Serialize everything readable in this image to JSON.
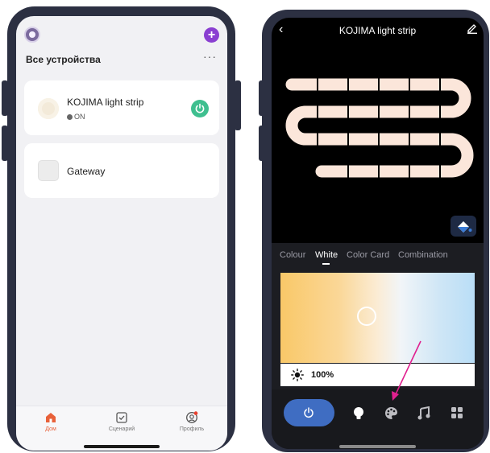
{
  "left_screen": {
    "header": {
      "avatar_icon": "avatar-icon",
      "add_icon": "plus-icon",
      "add_label": "+"
    },
    "section_title": "Все устройства",
    "more_label": "···",
    "devices": [
      {
        "name": "KOJIMA light strip",
        "status": "ON",
        "icon": "light-icon",
        "power_icon": "power-icon"
      },
      {
        "name": "Gateway",
        "icon": "gateway-icon"
      }
    ],
    "tabs": [
      {
        "label": "Дом",
        "icon": "home-icon",
        "active": true
      },
      {
        "label": "Сценарий",
        "icon": "checkbox-icon",
        "active": false
      },
      {
        "label": "Профиль",
        "icon": "profile-icon",
        "active": false
      }
    ]
  },
  "right_screen": {
    "header": {
      "back_label": "‹",
      "title": "KOJIMA light strip",
      "edit_icon": "pencil-icon"
    },
    "mode_tabs": [
      {
        "label": "Colour",
        "active": false
      },
      {
        "label": "White",
        "active": true
      },
      {
        "label": "Color Card",
        "active": false
      },
      {
        "label": "Combination",
        "active": false
      }
    ],
    "brightness": {
      "value_label": "100%",
      "icon": "sun-icon"
    },
    "bottom_icons": [
      "power-icon",
      "bulb-icon",
      "palette-icon",
      "music-icon",
      "grid-icon"
    ]
  },
  "colors": {
    "accent_purple": "#8a3fd1",
    "power_green": "#3fbf8f",
    "active_tab": "#e8613a",
    "power_blue": "#3f6dc2",
    "arrow_pink": "#e0208f",
    "strip": "#fbe6da"
  }
}
